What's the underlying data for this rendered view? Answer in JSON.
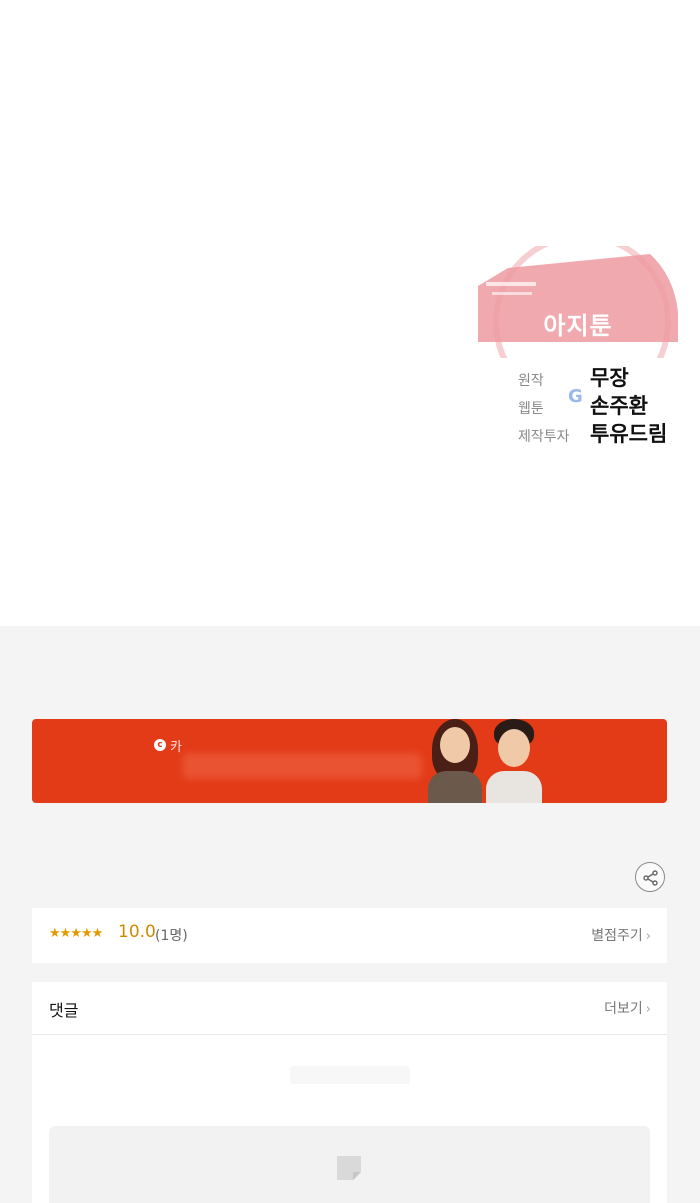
{
  "credits": {
    "stamp_title": "아지툰",
    "rows": [
      {
        "role": "원작",
        "name": "무장"
      },
      {
        "role": "웹툰",
        "name": "손주환"
      },
      {
        "role": "제작투자",
        "name": "투유드림"
      }
    ],
    "google_mark": "G"
  },
  "banner": {
    "logo_letter": "c",
    "text": "카",
    "background": "#e33a17"
  },
  "share": {
    "icon": "share-icon"
  },
  "rating": {
    "stars": "★★★★★",
    "score": "10.0",
    "count": "(1명)",
    "action_label": "별점주기"
  },
  "comments": {
    "title": "댓글",
    "more_label": "더보기"
  },
  "colors": {
    "accent_orange": "#e33a17",
    "star": "#e39a00",
    "page_bg": "#f4f4f4"
  }
}
